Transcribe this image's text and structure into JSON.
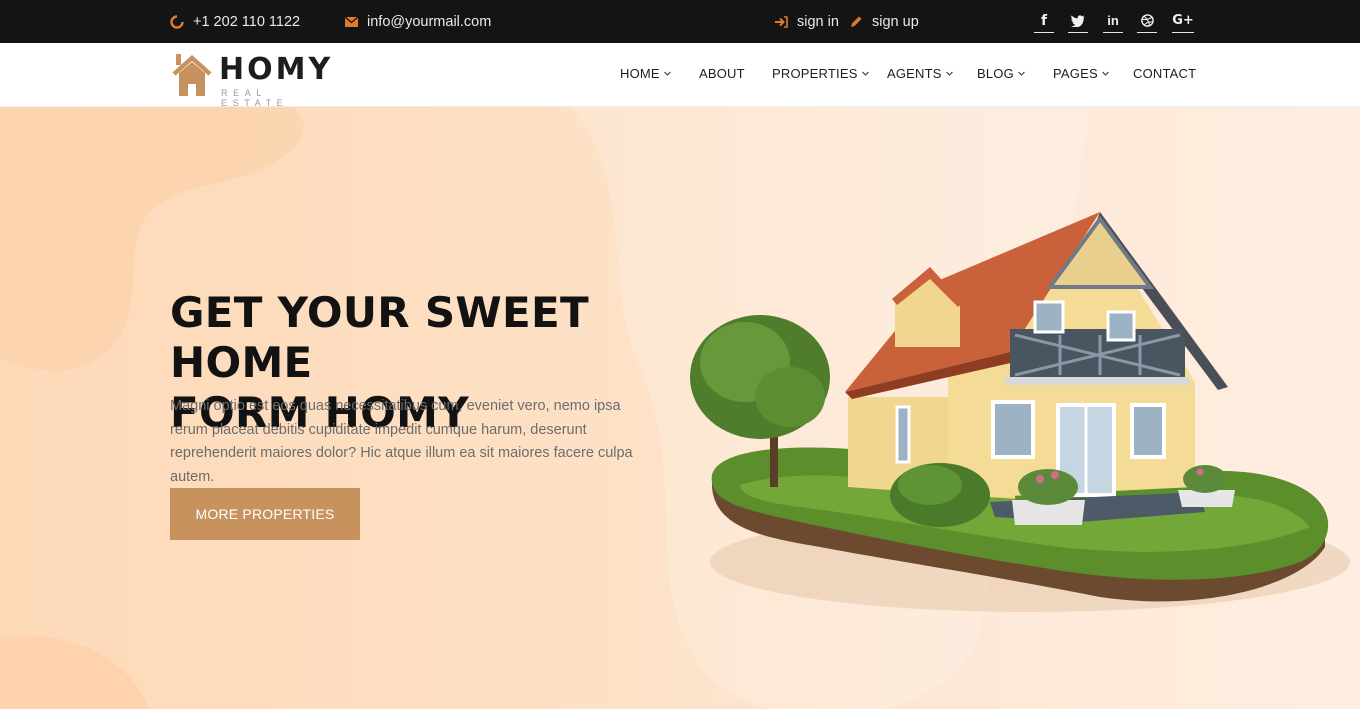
{
  "topbar": {
    "phone": "+1 202 110 1122",
    "email": "info@yourmail.com",
    "sign_in": "sign in",
    "sign_up": "sign up",
    "social": [
      {
        "icon": "facebook-icon",
        "glyph": "f"
      },
      {
        "icon": "twitter-icon",
        "glyph": "t"
      },
      {
        "icon": "linkedin-icon",
        "glyph": "in"
      },
      {
        "icon": "dribbble-icon",
        "glyph": "d"
      },
      {
        "icon": "google-plus-icon",
        "glyph": "G+"
      }
    ]
  },
  "brand": {
    "name": "HOMY",
    "tagline": "REAL ESTATE",
    "accent": "#c8925e"
  },
  "nav": {
    "items": [
      {
        "label": "HOME",
        "dropdown": true
      },
      {
        "label": "ABOUT",
        "dropdown": false
      },
      {
        "label": "PROPERTIES",
        "dropdown": true
      },
      {
        "label": "AGENTS",
        "dropdown": true
      },
      {
        "label": "BLOG",
        "dropdown": true
      },
      {
        "label": "PAGES",
        "dropdown": true
      },
      {
        "label": "CONTACT",
        "dropdown": false
      }
    ]
  },
  "hero": {
    "title_line1": "GET YOUR SWEET HOME",
    "title_line2": "FORM HOMY",
    "text": "Magni optio est eos quas necessitatibus cum, eveniet vero, nemo ipsa rerum placeat debitis cupiditate impedit cumque harum, deserunt reprehenderit maiores dolor? Hic atque illum ea sit maiores facere culpa autem.",
    "button": "MORE PROPERTIES"
  }
}
